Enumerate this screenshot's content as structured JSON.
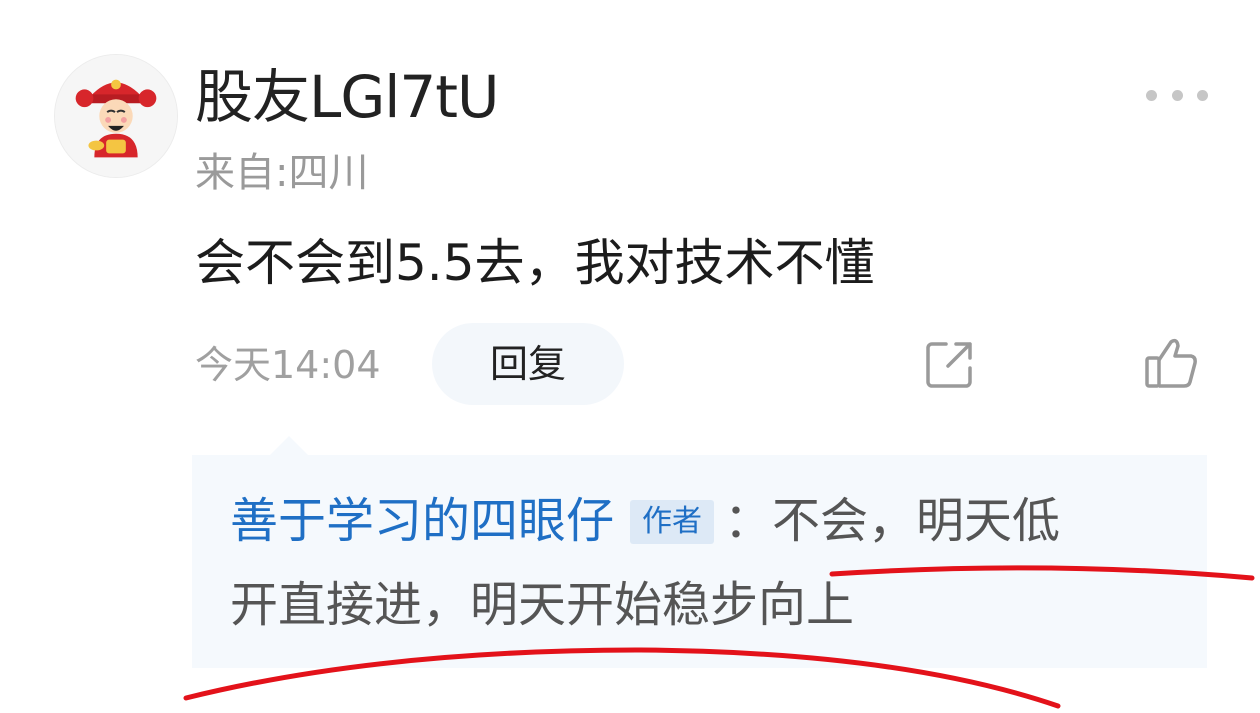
{
  "comment": {
    "username": "股友LGl7tU",
    "location": "来自:四川",
    "text": "会不会到5.5去，我对技术不懂",
    "time": "今天14:04",
    "reply_label": "回复"
  },
  "reply": {
    "author": "善于学习的四眼仔",
    "author_tag": "作者",
    "line1": "：不会，明天低",
    "line2": "开直接进，明天开始稳步向上"
  },
  "icons": {
    "more": "more-dots-icon",
    "share": "share-icon",
    "like": "thumbs-up-icon",
    "avatar": "caishen-avatar"
  },
  "colors": {
    "author_link": "#1f6fc5",
    "reply_bg": "#f5f9fd",
    "annotation": "#e3121a",
    "secondary_text": "#9a9a9a"
  }
}
